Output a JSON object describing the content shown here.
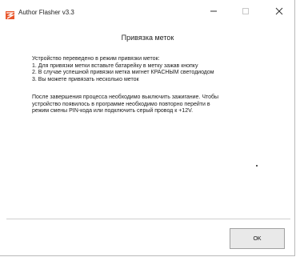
{
  "window": {
    "title": "Author Flasher v3.3",
    "accent_color": "#d64a1e"
  },
  "titlebar_buttons": [
    {
      "name": "minimize",
      "icon": "minimize-icon"
    },
    {
      "name": "maximize",
      "icon": "maximize-icon",
      "enabled": false
    },
    {
      "name": "close",
      "icon": "close-icon"
    }
  ],
  "dialog": {
    "heading": "Привязка меток",
    "paragraph1": "Устройство переведено в режим привязки меток:\n1. Для привязки метки вставьте батарейку в метку зажав кнопку\n2. В случае успешной привязки метка мигнет КРАСНЫМ светодиодом\n3. Вы можете привязать несколько меток",
    "paragraph2": "После завершения процесса необходимо выключить зажигание. Чтобы\nустройство появилось в программе необходимо повторно перейти в\nрежим смены PIN-кода или подключить серый провод к +12V.",
    "ok_label": "OK"
  }
}
